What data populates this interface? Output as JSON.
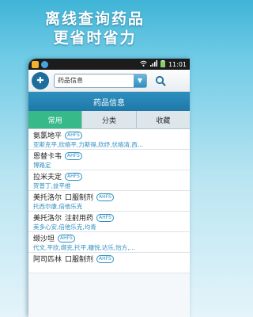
{
  "promo": {
    "line1": "离线查询药品",
    "line2": "更省时省力"
  },
  "statusbar": {
    "time": "11:01"
  },
  "search": {
    "category": "药品信息"
  },
  "page_title": "药品信息",
  "tabs": [
    {
      "label": "常用"
    },
    {
      "label": "分类"
    },
    {
      "label": "收藏"
    }
  ],
  "drugs": [
    {
      "name": "氨氯地平",
      "route": "",
      "badge": "AHFS",
      "aliases": "亚斯克平,欣络平,力斯得,欣纾,伏络清,西..."
    },
    {
      "name": "恩替卡韦",
      "route": "",
      "badge": "AHFS",
      "aliases": "博路定"
    },
    {
      "name": "拉米夫定",
      "route": "",
      "badge": "AHFS",
      "aliases": "贺普丁,益平维"
    },
    {
      "name": "美托洛尔",
      "route": "口服制剂",
      "badge": "AHFS",
      "aliases": "托西尔康,倍他乐克"
    },
    {
      "name": "美托洛尔",
      "route": "注射用药",
      "badge": "AHFS",
      "aliases": "美多心安,倍他乐克,均青"
    },
    {
      "name": "缬沙坦",
      "route": "",
      "badge": "AHFS",
      "aliases": "代文,平欣,缬克,托平,穗悦,达乐,怡方,..."
    },
    {
      "name": "阿司匹林",
      "route": "口服制剂",
      "badge": "AHFS",
      "aliases": ""
    }
  ]
}
